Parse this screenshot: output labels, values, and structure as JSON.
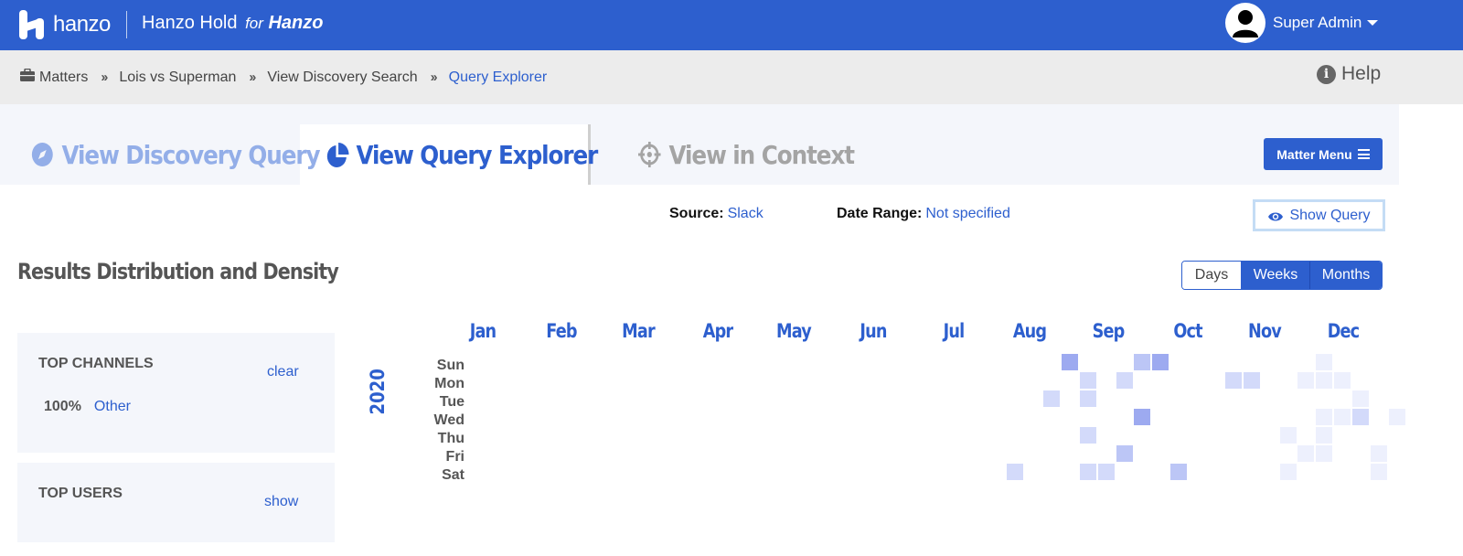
{
  "header": {
    "logo_text": "hanzo",
    "app_name": "Hanzo Hold",
    "app_for": "for",
    "app_brand": "Hanzo",
    "user_name": "Super Admin",
    "brand_color": "#2d5fce"
  },
  "breadcrumb": {
    "items": [
      "Matters",
      "Lois vs Superman",
      "View Discovery Search",
      "Query Explorer"
    ],
    "help_label": "Help"
  },
  "tabs": [
    {
      "label": "View Discovery Query",
      "icon": "compass-icon"
    },
    {
      "label": "View Query Explorer",
      "icon": "pie-chart-icon",
      "active": true
    },
    {
      "label": "View in Context",
      "icon": "crosshairs-icon"
    }
  ],
  "matter_menu_label": "Matter Menu",
  "filters": {
    "source_label": "Source:",
    "source_value": "Slack",
    "date_label": "Date Range:",
    "date_value": "Not specified",
    "show_query_label": "Show Query"
  },
  "results": {
    "title": "Results Distribution and Density",
    "periods": [
      "Days",
      "Weeks",
      "Months"
    ],
    "selected_periods": [
      "Weeks",
      "Months"
    ]
  },
  "top_channels": {
    "title": "TOP CHANNELS",
    "action": "clear",
    "items": [
      {
        "pct": "100%",
        "name": "Other"
      }
    ]
  },
  "top_users": {
    "title": "TOP USERS",
    "action": "show"
  },
  "heatmap": {
    "year": "2020",
    "months": [
      "Jan",
      "Feb",
      "Mar",
      "Apr",
      "May",
      "Jun",
      "Jul",
      "Aug",
      "Sep",
      "Oct",
      "Nov",
      "Dec"
    ],
    "days": [
      "Sun",
      "Mon",
      "Tue",
      "Wed",
      "Thu",
      "Fri",
      "Sat"
    ],
    "cells": [
      {
        "week": 35,
        "day": 6,
        "level": 2
      },
      {
        "week": 37,
        "day": 2,
        "level": 2
      },
      {
        "week": 38,
        "day": 0,
        "level": 4
      },
      {
        "week": 39,
        "day": 1,
        "level": 2
      },
      {
        "week": 39,
        "day": 2,
        "level": 2
      },
      {
        "week": 39,
        "day": 4,
        "level": 2
      },
      {
        "week": 39,
        "day": 6,
        "level": 2
      },
      {
        "week": 40,
        "day": 6,
        "level": 2
      },
      {
        "week": 41,
        "day": 1,
        "level": 2
      },
      {
        "week": 41,
        "day": 5,
        "level": 3
      },
      {
        "week": 42,
        "day": 0,
        "level": 3
      },
      {
        "week": 42,
        "day": 3,
        "level": 4
      },
      {
        "week": 43,
        "day": 0,
        "level": 4
      },
      {
        "week": 44,
        "day": 6,
        "level": 3
      },
      {
        "week": 47,
        "day": 1,
        "level": 2
      },
      {
        "week": 48,
        "day": 1,
        "level": 2
      },
      {
        "week": 50,
        "day": 4,
        "level": 1
      },
      {
        "week": 50,
        "day": 6,
        "level": 1
      },
      {
        "week": 51,
        "day": 1,
        "level": 1
      },
      {
        "week": 51,
        "day": 5,
        "level": 1
      },
      {
        "week": 52,
        "day": 0,
        "level": 1
      },
      {
        "week": 52,
        "day": 1,
        "level": 1
      },
      {
        "week": 52,
        "day": 3,
        "level": 1
      },
      {
        "week": 52,
        "day": 4,
        "level": 1
      },
      {
        "week": 52,
        "day": 5,
        "level": 1
      },
      {
        "week": 53,
        "day": 1,
        "level": 1
      },
      {
        "week": 53,
        "day": 3,
        "level": 1
      },
      {
        "week": 54,
        "day": 2,
        "level": 1
      },
      {
        "week": 54,
        "day": 3,
        "level": 2
      },
      {
        "week": 55,
        "day": 5,
        "level": 1
      },
      {
        "week": 55,
        "day": 6,
        "level": 1
      },
      {
        "week": 56,
        "day": 3,
        "level": 1
      }
    ],
    "level_colors": [
      "#ffffff",
      "#edf0fd",
      "#d3dafa",
      "#bcc6f6",
      "#9daaf0"
    ]
  }
}
